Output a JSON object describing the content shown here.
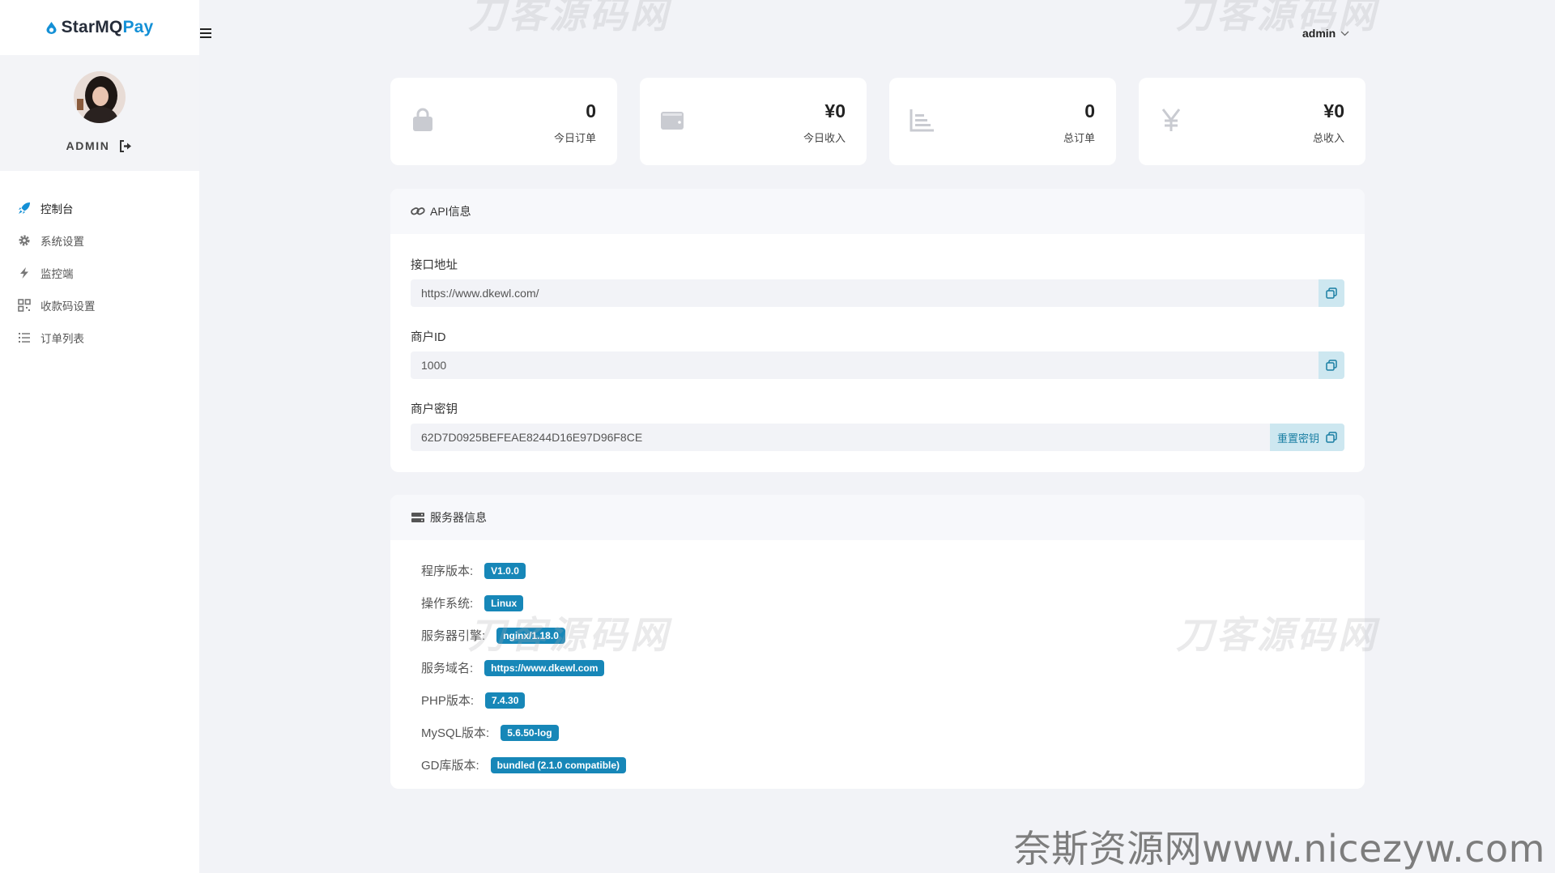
{
  "brand": {
    "name_part1": "StarMQ",
    "name_part2": "Pay",
    "accent_color": "#1490d6"
  },
  "user": {
    "name": "ADMIN",
    "menu_label": "admin"
  },
  "nav": [
    {
      "label": "控制台",
      "icon": "rocket-icon"
    },
    {
      "label": "系统设置",
      "icon": "gear-icon"
    },
    {
      "label": "监控端",
      "icon": "bolt-icon"
    },
    {
      "label": "收款码设置",
      "icon": "qrcode-icon"
    },
    {
      "label": "订单列表",
      "icon": "list-icon"
    }
  ],
  "stats": [
    {
      "value": "0",
      "label": "今日订单",
      "icon": "bag-icon"
    },
    {
      "value": "¥0",
      "label": "今日收入",
      "icon": "wallet-icon"
    },
    {
      "value": "0",
      "label": "总订单",
      "icon": "chart-icon"
    },
    {
      "value": "¥0",
      "label": "总收入",
      "icon": "yen-icon"
    }
  ],
  "api": {
    "title": "API信息",
    "endpoint_label": "接口地址",
    "endpoint_value": "https://www.dkewl.com/",
    "merchant_label": "商户ID",
    "merchant_value": "1000",
    "key_label": "商户密钥",
    "key_value": "62D7D0925BEFEAE8244D16E97D96F8CE",
    "reset_label": "重置密钥"
  },
  "server": {
    "title": "服务器信息",
    "rows": [
      {
        "label": "程序版本:",
        "value": "V1.0.0"
      },
      {
        "label": "操作系统:",
        "value": "Linux"
      },
      {
        "label": "服务器引擎:",
        "value": "nginx/1.18.0"
      },
      {
        "label": "服务域名:",
        "value": "https://www.dkewl.com"
      },
      {
        "label": "PHP版本:",
        "value": "7.4.30"
      },
      {
        "label": "MySQL版本:",
        "value": "5.6.50-log"
      },
      {
        "label": "GD库版本:",
        "value": "bundled (2.1.0 compatible)"
      }
    ]
  },
  "watermarks": {
    "overlay": "刀客源码网",
    "footer": "奈斯资源网www.nicezyw.com"
  }
}
